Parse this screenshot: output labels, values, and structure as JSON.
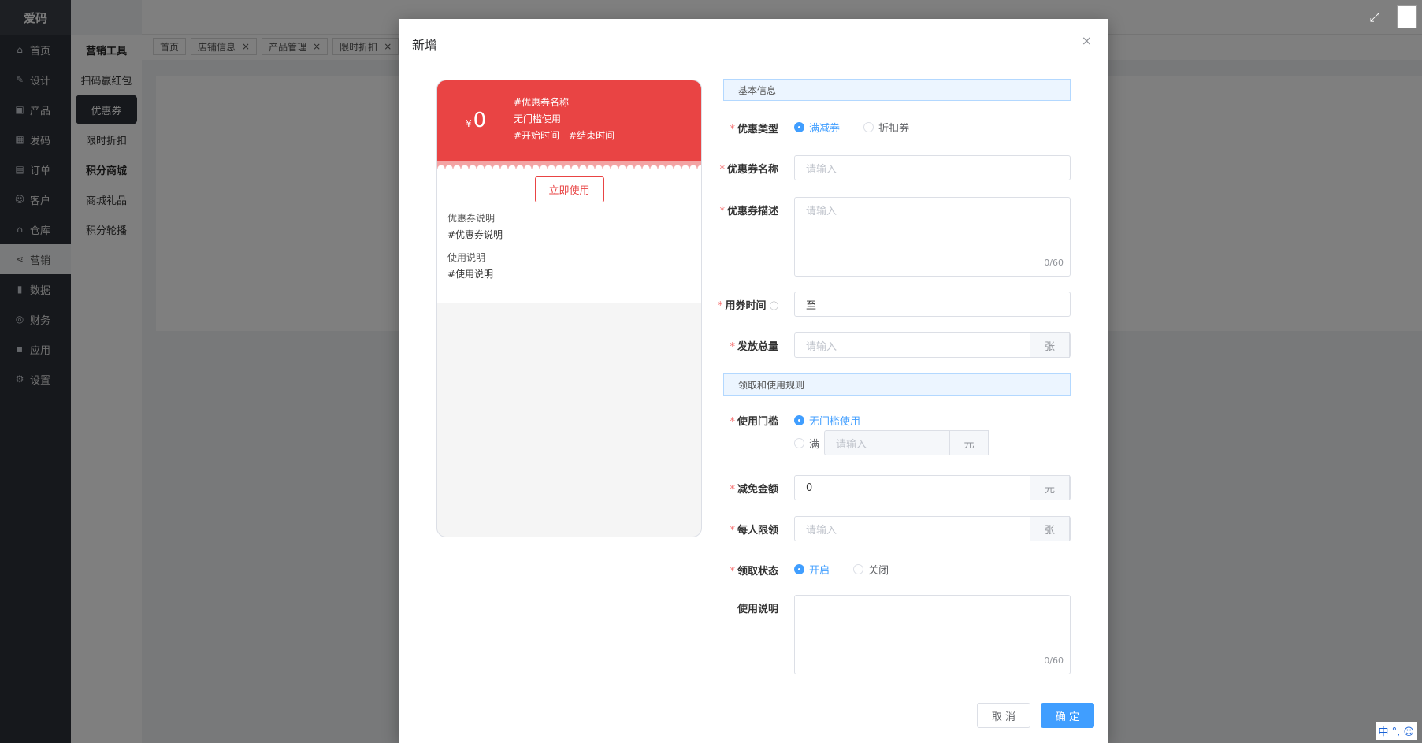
{
  "app": {
    "logo": "爱码",
    "brand_color": "#409eff"
  },
  "sidebar": {
    "items": [
      {
        "label": "首页",
        "icon": "home-icon"
      },
      {
        "label": "设计",
        "icon": "design-icon"
      },
      {
        "label": "产品",
        "icon": "box-icon"
      },
      {
        "label": "发码",
        "icon": "qrcode-icon"
      },
      {
        "label": "订单",
        "icon": "order-icon"
      },
      {
        "label": "客户",
        "icon": "user-icon"
      },
      {
        "label": "仓库",
        "icon": "warehouse-icon"
      },
      {
        "label": "营销",
        "icon": "share-icon"
      },
      {
        "label": "数据",
        "icon": "chart-icon"
      },
      {
        "label": "财务",
        "icon": "money-icon"
      },
      {
        "label": "应用",
        "icon": "apps-icon"
      },
      {
        "label": "设置",
        "icon": "gear-icon"
      }
    ]
  },
  "submenu": {
    "head1": "营销工具",
    "items1": [
      "扫码赢红包",
      "优惠券",
      "限时折扣"
    ],
    "head2": "积分商城",
    "items2": [
      "商城礼品",
      "积分轮播"
    ]
  },
  "tabs": [
    "首页",
    "店铺信息",
    "产品管理",
    "限时折扣"
  ],
  "modal": {
    "title": "新增",
    "close": "×",
    "preview": {
      "currency": "¥",
      "price": "0",
      "line1": "#优惠券名称",
      "line2": "无门槛使用",
      "line3": "#开始时间 - #结束时间",
      "use_button": "立即使用",
      "desc_label": "优惠券说明",
      "desc_value": "#优惠券说明",
      "usage_label": "使用说明",
      "usage_value": "#使用说明"
    },
    "form": {
      "section1": "基本信息",
      "type_label": "优惠类型",
      "type_opt1": "满减券",
      "type_opt2": "折扣券",
      "name_label": "优惠券名称",
      "name_placeholder": "请输入",
      "desc_label": "优惠券描述",
      "desc_placeholder": "请输入",
      "desc_count": "0/60",
      "time_label": "用券时间",
      "time_value": "至",
      "total_label": "发放总量",
      "total_placeholder": "请输入",
      "total_unit": "张",
      "section2": "领取和使用规则",
      "threshold_label": "使用门槛",
      "threshold_opt1": "无门槛使用",
      "threshold_opt2": "满",
      "threshold_placeholder": "请输入",
      "threshold_unit": "元",
      "discount_label": "减免金额",
      "discount_value": "0",
      "discount_unit": "元",
      "limit_label": "每人限领",
      "limit_placeholder": "请输入",
      "limit_unit": "张",
      "status_label": "领取状态",
      "status_opt1": "开启",
      "status_opt2": "关闭",
      "usage_label": "使用说明",
      "usage_count": "0/60"
    },
    "cancel": "取 消",
    "ok": "确 定"
  },
  "ime": "中 °, ☺"
}
